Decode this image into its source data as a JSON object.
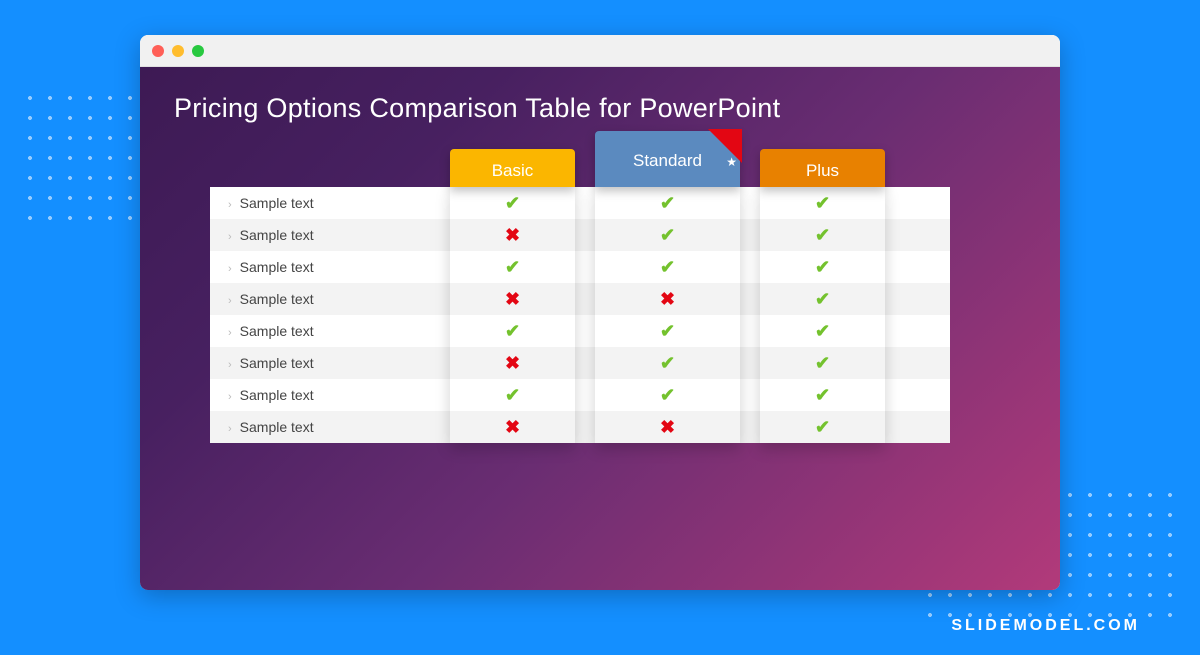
{
  "slide": {
    "title": "Pricing Options Comparison Table for PowerPoint"
  },
  "plans": {
    "basic": {
      "label": "Basic"
    },
    "standard": {
      "label": "Standard"
    },
    "plus": {
      "label": "Plus"
    }
  },
  "rows": [
    {
      "label": "Sample text",
      "basic": "check",
      "standard": "check",
      "plus": "check"
    },
    {
      "label": "Sample text",
      "basic": "cross",
      "standard": "check",
      "plus": "check"
    },
    {
      "label": "Sample text",
      "basic": "check",
      "standard": "check",
      "plus": "check"
    },
    {
      "label": "Sample text",
      "basic": "cross",
      "standard": "cross",
      "plus": "check"
    },
    {
      "label": "Sample text",
      "basic": "check",
      "standard": "check",
      "plus": "check"
    },
    {
      "label": "Sample text",
      "basic": "cross",
      "standard": "check",
      "plus": "check"
    },
    {
      "label": "Sample text",
      "basic": "check",
      "standard": "check",
      "plus": "check"
    },
    {
      "label": "Sample text",
      "basic": "cross",
      "standard": "cross",
      "plus": "check"
    }
  ],
  "brand": "SLIDEMODEL.COM",
  "glyphs": {
    "check": "✔",
    "cross": "✖",
    "chevron": "›",
    "star": "★"
  }
}
